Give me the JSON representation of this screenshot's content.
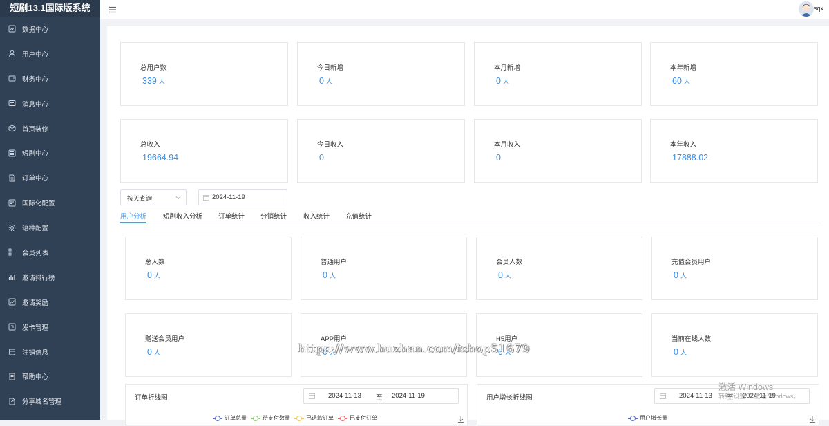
{
  "app": {
    "title": "短剧13.1国际版系统"
  },
  "header": {
    "username": "sqx"
  },
  "sidebar": {
    "items": [
      {
        "label": "数据中心",
        "icon": "dashboard-icon"
      },
      {
        "label": "用户中心",
        "icon": "user-icon"
      },
      {
        "label": "财务中心",
        "icon": "wallet-icon"
      },
      {
        "label": "消息中心",
        "icon": "message-icon"
      },
      {
        "label": "首页装修",
        "icon": "box-icon"
      },
      {
        "label": "短剧中心",
        "icon": "film-icon"
      },
      {
        "label": "订单中心",
        "icon": "document-icon"
      },
      {
        "label": "国际化配置",
        "icon": "globe-config-icon"
      },
      {
        "label": "语种配置",
        "icon": "gear-icon"
      },
      {
        "label": "会员列表",
        "icon": "list-icon"
      },
      {
        "label": "邀请排行榜",
        "icon": "bar-chart-icon"
      },
      {
        "label": "邀请奖励",
        "icon": "trend-icon"
      },
      {
        "label": "发卡管理",
        "icon": "card-icon"
      },
      {
        "label": "注销信息",
        "icon": "logout-icon"
      },
      {
        "label": "帮助中心",
        "icon": "help-doc-icon"
      },
      {
        "label": "分享域名管理",
        "icon": "share-icon"
      }
    ]
  },
  "stats_row1": [
    {
      "label": "总用户数",
      "value": "339",
      "unit": "人"
    },
    {
      "label": "今日新增",
      "value": "0",
      "unit": "人"
    },
    {
      "label": "本月新增",
      "value": "0",
      "unit": "人"
    },
    {
      "label": "本年新增",
      "value": "60",
      "unit": "人"
    }
  ],
  "stats_row2": [
    {
      "label": "总收入",
      "value": "19664.94"
    },
    {
      "label": "今日收入",
      "value": "0"
    },
    {
      "label": "本月收入",
      "value": "0"
    },
    {
      "label": "本年收入",
      "value": "17888.02"
    }
  ],
  "filter": {
    "select_value": "按天查询",
    "date": "2024-11-19"
  },
  "tabs": [
    "用户分析",
    "短剧收入分析",
    "订单统计",
    "分销统计",
    "收入统计",
    "充值统计"
  ],
  "user_stats_row1": [
    {
      "label": "总人数",
      "value": "0",
      "unit": "人"
    },
    {
      "label": "普通用户",
      "value": "0",
      "unit": "人"
    },
    {
      "label": "会员人数",
      "value": "0",
      "unit": "人"
    },
    {
      "label": "充值会员用户",
      "value": "0",
      "unit": "人"
    }
  ],
  "user_stats_row2": [
    {
      "label": "赠送会员用户",
      "value": "0",
      "unit": "人"
    },
    {
      "label": "APP用户",
      "value": "0",
      "unit": "人"
    },
    {
      "label": "H5用户",
      "value": "0",
      "unit": "人"
    },
    {
      "label": "当前在线人数",
      "value": "0",
      "unit": "人"
    }
  ],
  "order_chart": {
    "title": "订单折线图",
    "start": "2024-11-13",
    "separator": "至",
    "end": "2024-11-19",
    "legend": [
      {
        "name": "订单总量",
        "color": "#5470c6"
      },
      {
        "name": "待支付数量",
        "color": "#91cc75"
      },
      {
        "name": "已退款订单",
        "color": "#fac858"
      },
      {
        "name": "已支付订单",
        "color": "#ee6666"
      }
    ]
  },
  "user_chart": {
    "title": "用户增长折线图",
    "start": "2024-11-13",
    "separator": "至",
    "end": "2024-11-19",
    "legend": [
      {
        "name": "用户增长量",
        "color": "#5470c6"
      }
    ]
  },
  "overlay": {
    "watermark": "https://www.huzhan.com/ishop51679",
    "activate_title": "激活 Windows",
    "activate_sub": "转到\"设置\"以激活 Windows。"
  }
}
